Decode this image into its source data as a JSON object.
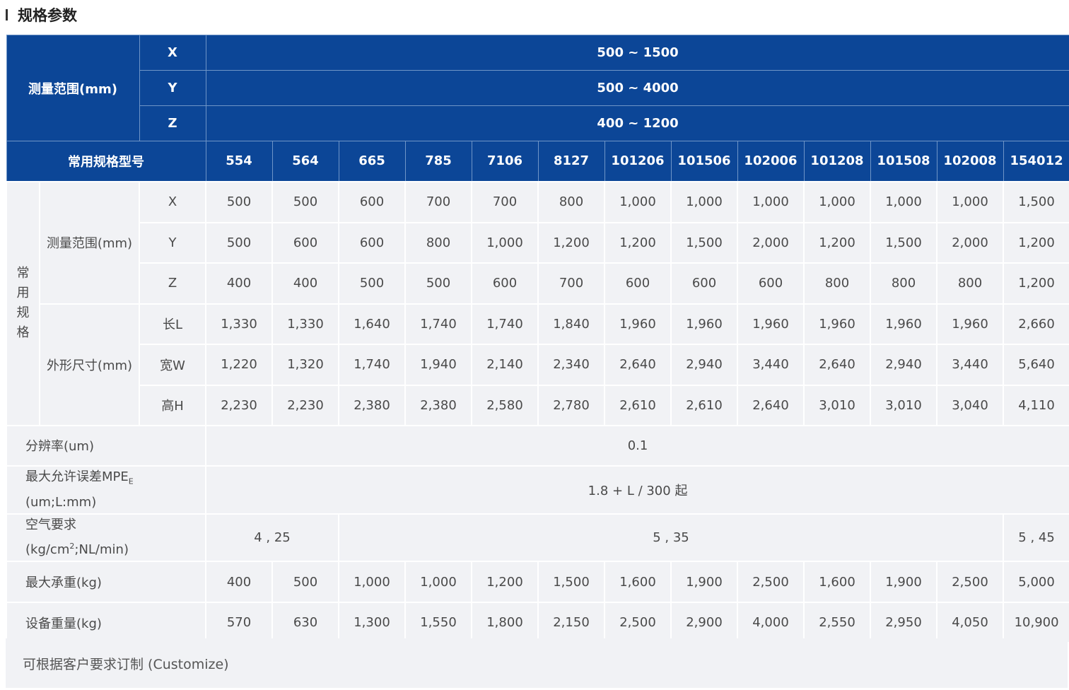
{
  "section_title": "规格参数",
  "header": {
    "range_label": "测量范围(mm)",
    "axes": [
      {
        "axis": "X",
        "range": "500 ~ 1500"
      },
      {
        "axis": "Y",
        "range": "500 ~ 4000"
      },
      {
        "axis": "Z",
        "range": "400 ~ 1200"
      }
    ],
    "models_label": "常用规格型号",
    "models": [
      "554",
      "564",
      "665",
      "785",
      "7106",
      "8127",
      "101206",
      "101506",
      "102006",
      "101208",
      "101508",
      "102008",
      "154012"
    ]
  },
  "common_group_label": "常\n用\n规\n格",
  "range_group_label": "测量范围(mm)",
  "dim_group_label": "外形尺寸(mm)",
  "rows": {
    "x": {
      "label": "X",
      "values": [
        "500",
        "500",
        "600",
        "700",
        "700",
        "800",
        "1,000",
        "1,000",
        "1,000",
        "1,000",
        "1,000",
        "1,000",
        "1,500"
      ]
    },
    "y": {
      "label": "Y",
      "values": [
        "500",
        "600",
        "600",
        "800",
        "1,000",
        "1,200",
        "1,200",
        "1,500",
        "2,000",
        "1,200",
        "1,500",
        "2,000",
        "1,200"
      ]
    },
    "z": {
      "label": "Z",
      "values": [
        "400",
        "400",
        "500",
        "500",
        "600",
        "700",
        "600",
        "600",
        "600",
        "800",
        "800",
        "800",
        "1,200"
      ]
    },
    "len": {
      "label": "长L",
      "values": [
        "1,330",
        "1,330",
        "1,640",
        "1,740",
        "1,740",
        "1,840",
        "1,960",
        "1,960",
        "1,960",
        "1,960",
        "1,960",
        "1,960",
        "2,660"
      ]
    },
    "wid": {
      "label": "宽W",
      "values": [
        "1,220",
        "1,320",
        "1,740",
        "1,940",
        "2,140",
        "2,340",
        "2,640",
        "2,940",
        "3,440",
        "2,640",
        "2,940",
        "3,440",
        "5,640"
      ]
    },
    "hgt": {
      "label": "高H",
      "values": [
        "2,230",
        "2,230",
        "2,380",
        "2,380",
        "2,580",
        "2,780",
        "2,610",
        "2,610",
        "2,640",
        "3,010",
        "3,010",
        "3,040",
        "4,110"
      ]
    }
  },
  "resolution": {
    "label": "分辨率(um)",
    "value": "0.1"
  },
  "mpe": {
    "label_prefix": "最大允许误差MPE",
    "label_sub": "E",
    "label_line2": "(um;L:mm)",
    "value": "1.8 + L / 300 起"
  },
  "air": {
    "label_line1": "空气要求",
    "label_pre": "(kg/cm",
    "label_sup": "2",
    "label_post": ";NL/min)",
    "values": [
      "4 , 25",
      "5 , 35",
      "5 , 45"
    ]
  },
  "max_load": {
    "label": "最大承重(kg)",
    "values": [
      "400",
      "500",
      "1,000",
      "1,000",
      "1,200",
      "1,500",
      "1,600",
      "1,900",
      "2,500",
      "1,600",
      "1,900",
      "2,500",
      "5,000"
    ]
  },
  "weight": {
    "label": "设备重量(kg)",
    "values": [
      "570",
      "630",
      "1,300",
      "1,550",
      "1,800",
      "2,150",
      "2,500",
      "2,900",
      "4,000",
      "2,550",
      "2,950",
      "4,050",
      "10,900"
    ]
  },
  "note": "可根据客户要求订制 (Customize)"
}
